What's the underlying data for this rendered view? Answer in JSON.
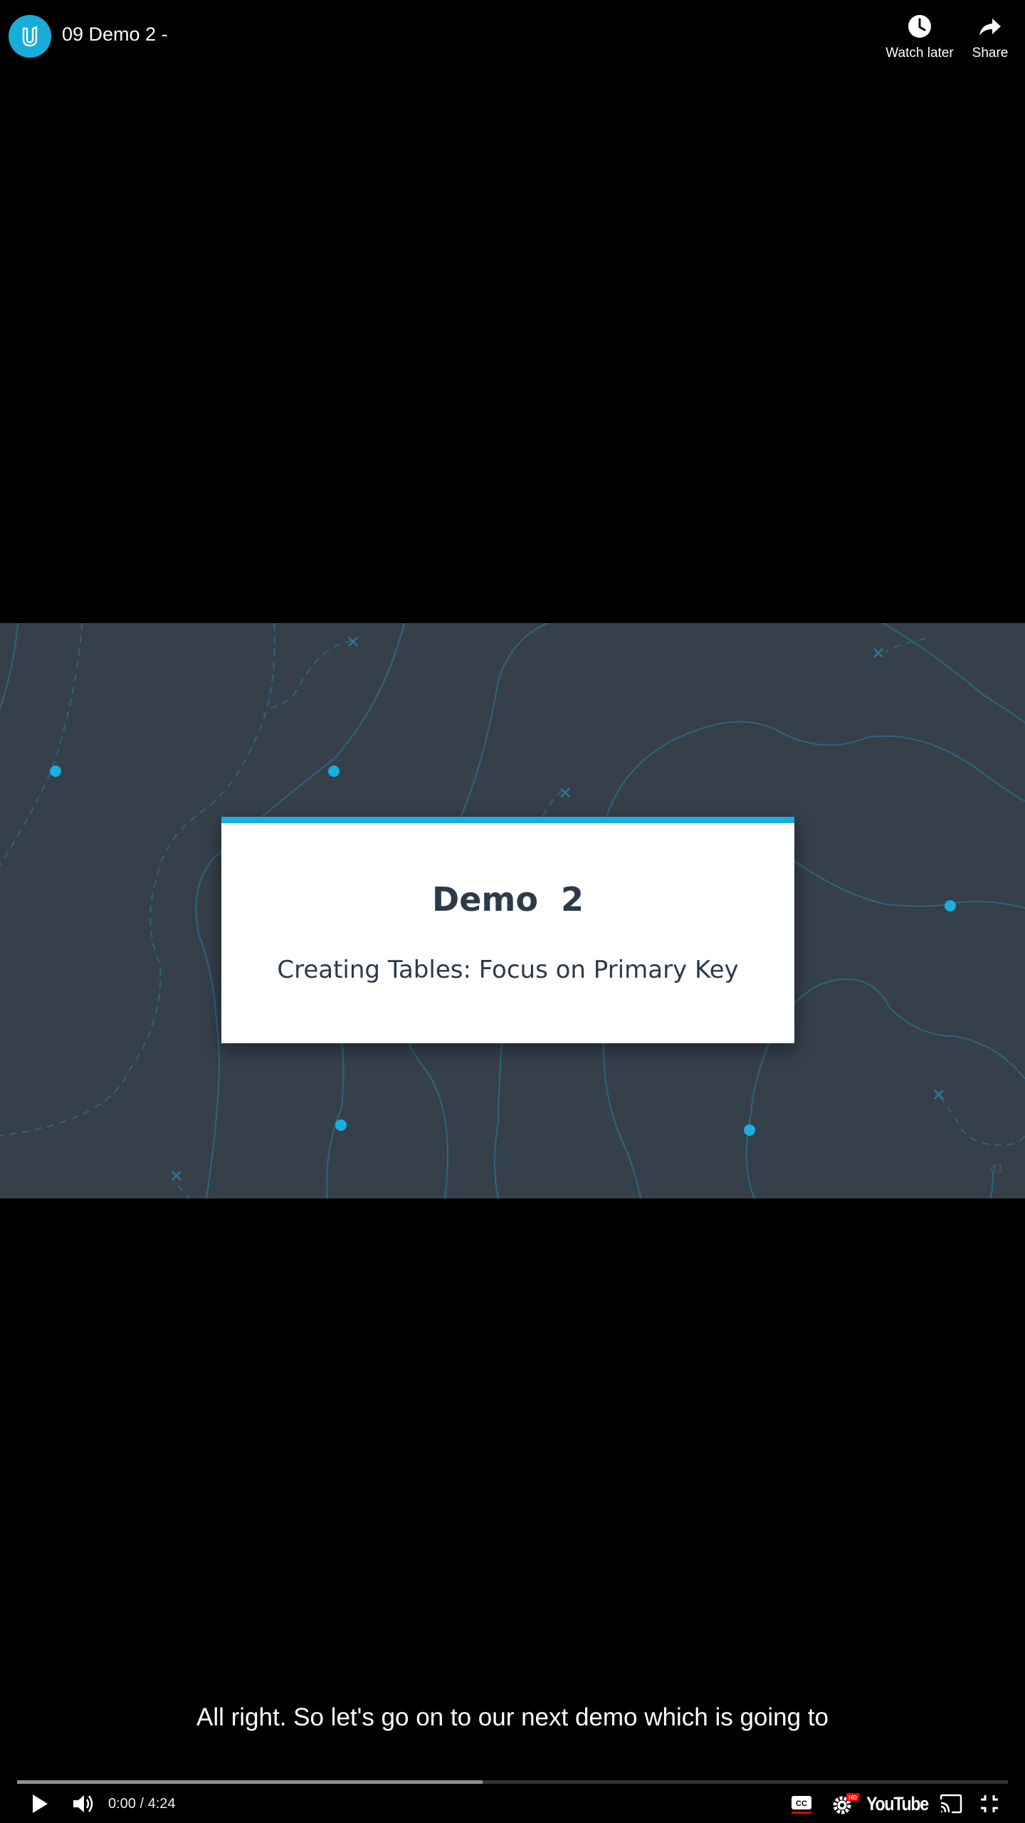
{
  "header": {
    "title": "09 Demo 2 -",
    "watch_later_label": "Watch later",
    "share_label": "Share"
  },
  "slide": {
    "title": "Demo  2",
    "subtitle": "Creating Tables: Focus on Primary Key",
    "page_number": "41",
    "accent_color": "#19aee0",
    "background_color": "#36404b"
  },
  "caption": {
    "text": "All right. So let's go on to our next demo which is going to"
  },
  "controls": {
    "current_time": "0:00",
    "duration": "4:24",
    "time_separator": " / ",
    "buffered_fraction": 0.47,
    "played_fraction": 0.0,
    "brand": "YouTube",
    "settings_badge": "HD",
    "icons": [
      "play-icon",
      "volume-icon",
      "captions-icon",
      "settings-icon",
      "youtube-logo",
      "cast-icon",
      "exit-fullscreen-icon"
    ]
  }
}
